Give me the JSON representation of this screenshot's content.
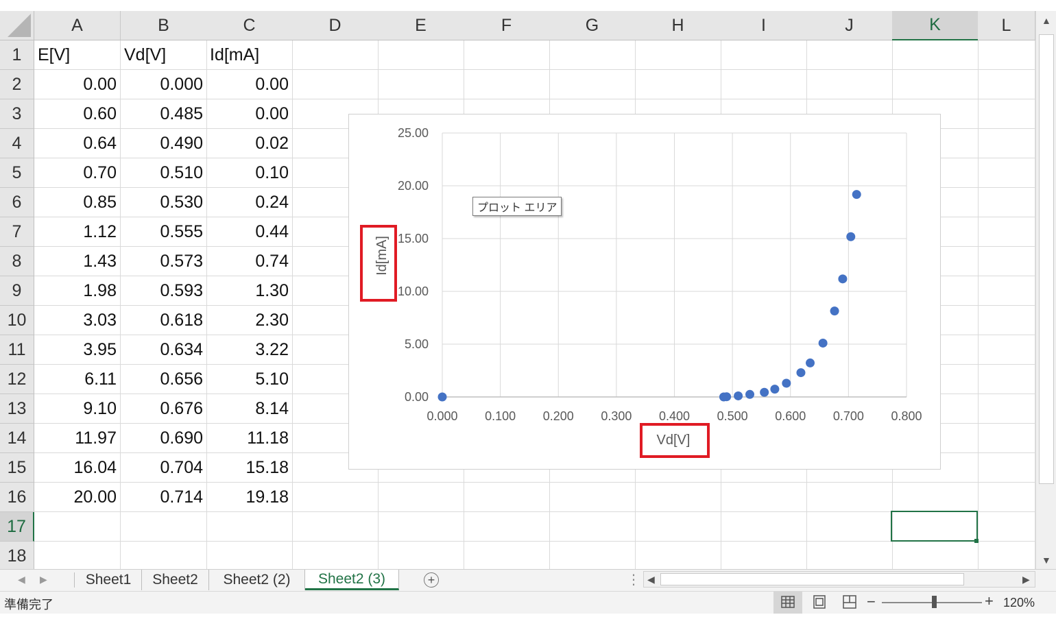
{
  "columns": [
    "A",
    "B",
    "C",
    "D",
    "E",
    "F",
    "G",
    "H",
    "I",
    "J",
    "K",
    "L"
  ],
  "rows": [
    "1",
    "2",
    "3",
    "4",
    "5",
    "6",
    "7",
    "8",
    "9",
    "10",
    "11",
    "12",
    "13",
    "14",
    "15",
    "16",
    "17",
    "18"
  ],
  "headers": {
    "a": "E[V]",
    "b": "Vd[V]",
    "c": "Id[mA]"
  },
  "table": [
    [
      "0.00",
      "0.000",
      "0.00"
    ],
    [
      "0.60",
      "0.485",
      "0.00"
    ],
    [
      "0.64",
      "0.490",
      "0.02"
    ],
    [
      "0.70",
      "0.510",
      "0.10"
    ],
    [
      "0.85",
      "0.530",
      "0.24"
    ],
    [
      "1.12",
      "0.555",
      "0.44"
    ],
    [
      "1.43",
      "0.573",
      "0.74"
    ],
    [
      "1.98",
      "0.593",
      "1.30"
    ],
    [
      "3.03",
      "0.618",
      "2.30"
    ],
    [
      "3.95",
      "0.634",
      "3.22"
    ],
    [
      "6.11",
      "0.656",
      "5.10"
    ],
    [
      "9.10",
      "0.676",
      "8.14"
    ],
    [
      "11.97",
      "0.690",
      "11.18"
    ],
    [
      "16.04",
      "0.704",
      "15.18"
    ],
    [
      "20.00",
      "0.714",
      "19.18"
    ]
  ],
  "chart_data": {
    "type": "scatter",
    "x": [
      0.0,
      0.485,
      0.49,
      0.51,
      0.53,
      0.555,
      0.573,
      0.593,
      0.618,
      0.634,
      0.656,
      0.676,
      0.69,
      0.704,
      0.714
    ],
    "y": [
      0.0,
      0.0,
      0.02,
      0.1,
      0.24,
      0.44,
      0.74,
      1.3,
      2.3,
      3.22,
      5.1,
      8.14,
      11.18,
      15.18,
      19.18
    ],
    "xlabel": "Vd[V]",
    "ylabel": "Id[mA]",
    "xlim": [
      0,
      0.8
    ],
    "ylim": [
      0,
      25
    ],
    "x_ticks": [
      "0.000",
      "0.100",
      "0.200",
      "0.300",
      "0.400",
      "0.500",
      "0.600",
      "0.700",
      "0.800"
    ],
    "y_ticks": [
      "0.00",
      "5.00",
      "10.00",
      "15.00",
      "20.00",
      "25.00"
    ],
    "grid": true,
    "marker_color": "#4472c4"
  },
  "tooltip": "プロット エリア",
  "sheets": [
    "Sheet1",
    "Sheet2",
    "Sheet2 (2)",
    "Sheet2 (3)"
  ],
  "active_sheet": "Sheet2 (3)",
  "status": {
    "ready": "準備完了",
    "zoom": "120%"
  },
  "colors": {
    "accent": "#217346",
    "highlight": "#e01b24"
  }
}
